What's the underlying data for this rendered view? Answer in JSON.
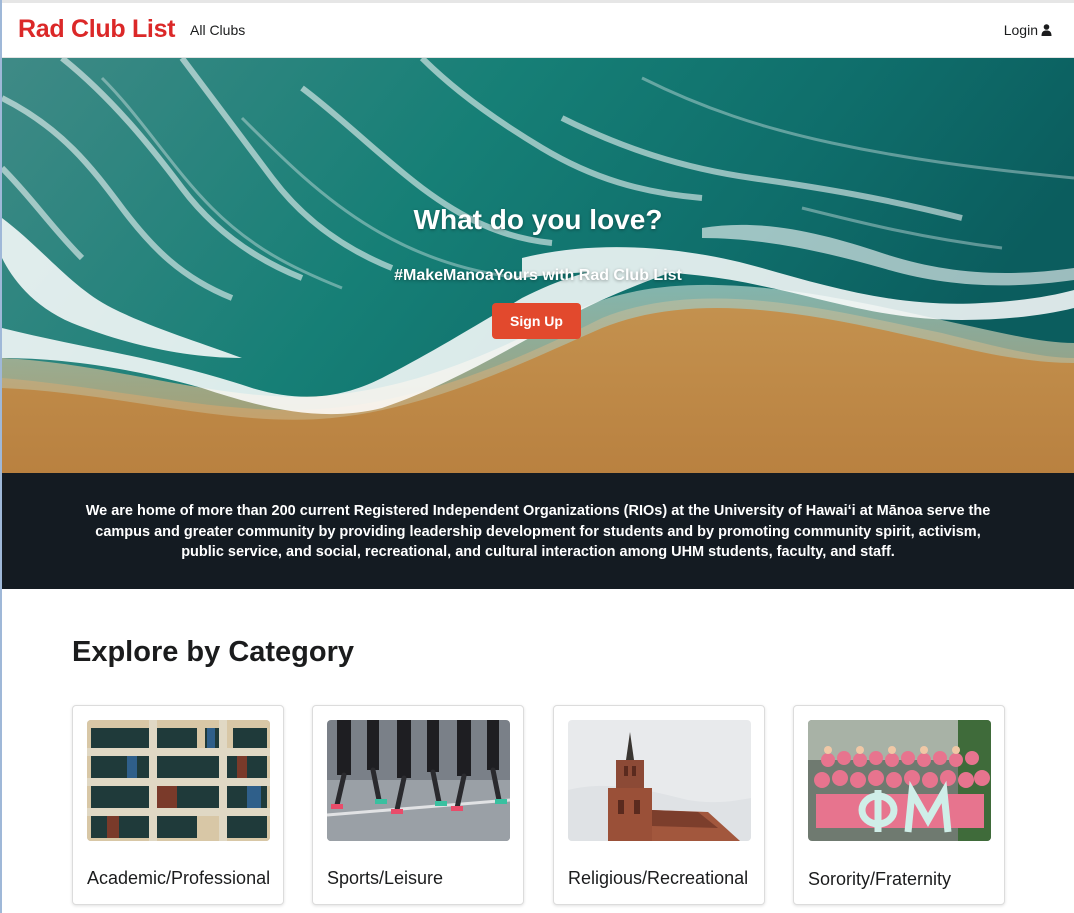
{
  "navbar": {
    "brand": "Rad Club List",
    "all_clubs": "All Clubs",
    "login": "Login",
    "login_icon": "user-icon"
  },
  "hero": {
    "title": "What do you love?",
    "subtitle": "#MakeManoaYours with Rad Club List",
    "signup_label": "Sign Up",
    "image": "ocean-waves-beach-aerial"
  },
  "info": {
    "text": "We are home of more than 200 current Registered Independent Organizations (RIOs) at the University of Hawaiʻi at Mānoa serve the campus and greater community by providing leadership development for students and by promoting community spirit, activism, public service, and social, recreational, and cultural interaction among UHM students, faculty, and staff."
  },
  "categories": {
    "title": "Explore by Category",
    "items": [
      {
        "label": "Academic/Professional",
        "image": "bookshelf-photo"
      },
      {
        "label": "Sports/Leisure",
        "image": "runners-photo"
      },
      {
        "label": "Religious/Recreational",
        "image": "church-tower-photo"
      },
      {
        "label": "Sorority/Fraternity",
        "image": "sorority-group-photo"
      }
    ]
  },
  "colors": {
    "brand": "#db2828",
    "signup": "#e2492d",
    "band": "#141b22"
  }
}
